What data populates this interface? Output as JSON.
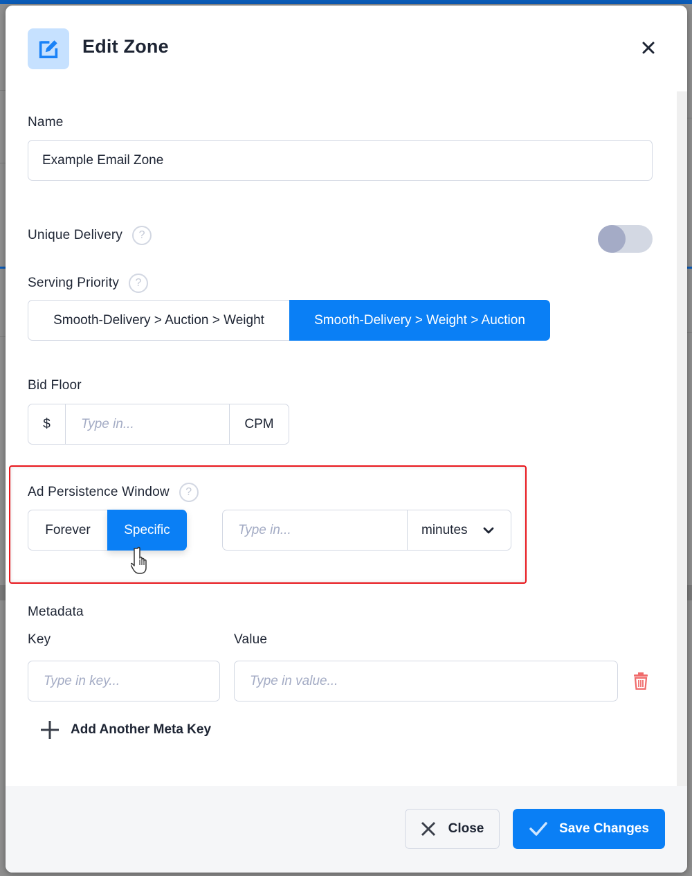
{
  "modal": {
    "title": "Edit Zone",
    "header_icon": "edit-square-icon",
    "close_icon": "close-icon"
  },
  "form": {
    "name": {
      "label": "Name",
      "value": "Example Email Zone"
    },
    "unique_delivery": {
      "label": "Unique Delivery",
      "help": "?",
      "enabled": false
    },
    "serving_priority": {
      "label": "Serving Priority",
      "help": "?",
      "options": [
        "Smooth-Delivery > Auction > Weight",
        "Smooth-Delivery > Weight > Auction"
      ],
      "selected": "Smooth-Delivery > Weight > Auction"
    },
    "bid_floor": {
      "label": "Bid Floor",
      "prefix": "$",
      "placeholder": "Type in...",
      "suffix": "CPM"
    },
    "ad_persistence": {
      "label": "Ad Persistence Window",
      "help": "?",
      "options": [
        "Forever",
        "Specific"
      ],
      "selected": "Specific",
      "placeholder": "Type in...",
      "unit": "minutes"
    },
    "metadata": {
      "label": "Metadata",
      "key_label": "Key",
      "value_label": "Value",
      "key_placeholder": "Type in key...",
      "value_placeholder": "Type in value...",
      "add_label": "Add Another Meta Key"
    }
  },
  "footer": {
    "close_label": "Close",
    "save_label": "Save Changes"
  },
  "colors": {
    "accent": "#0a7ff5",
    "highlight_border": "#e8161c",
    "delete": "#f06b6b"
  }
}
